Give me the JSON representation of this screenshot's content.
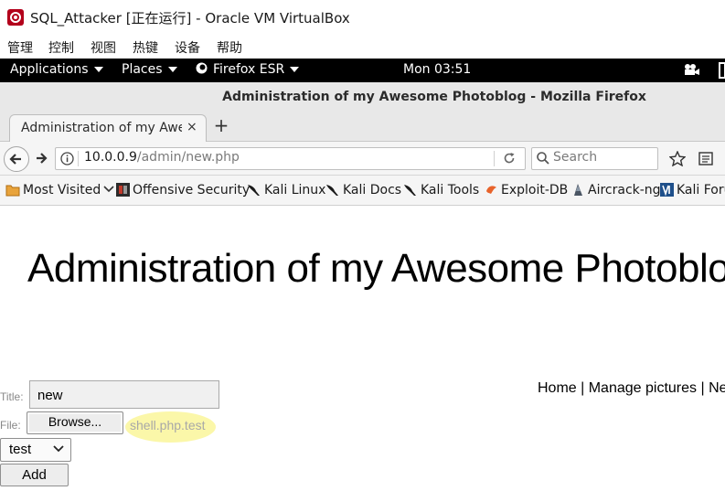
{
  "vbox": {
    "title": "SQL_Attacker [正在运行] - Oracle VM VirtualBox",
    "menu": [
      "管理",
      "控制",
      "视图",
      "热键",
      "设备",
      "帮助"
    ]
  },
  "gnome": {
    "applications": "Applications",
    "places": "Places",
    "firefox": "Firefox ESR",
    "clock": "Mon 03:51"
  },
  "firefox": {
    "window_title": "Administration of my Awesome Photoblog - Mozilla Firefox",
    "tab_label": "Administration of my Awe...",
    "tab_close": "×",
    "new_tab": "+",
    "url_host": "10.0.0.9",
    "url_path": "/admin/new.php",
    "search_placeholder": "Search",
    "bookmarks": [
      "Most Visited",
      "Offensive Security",
      "Kali Linux",
      "Kali Docs",
      "Kali Tools",
      "Exploit-DB",
      "Aircrack-ng",
      "Kali Forums"
    ]
  },
  "page": {
    "heading": "Administration of my Awesome Photoblog",
    "nav_links": "Home | Manage pictures | New picture",
    "title_label": "Title:",
    "title_value": "new",
    "file_label": "File:",
    "browse_label": "Browse...",
    "file_name": "shell.php.test",
    "category_value": "test",
    "add_label": "Add"
  },
  "colors": {
    "gnome_bar": "#000000",
    "highlight": "#fbf6a0",
    "window_chrome": "#e8e8e8"
  }
}
